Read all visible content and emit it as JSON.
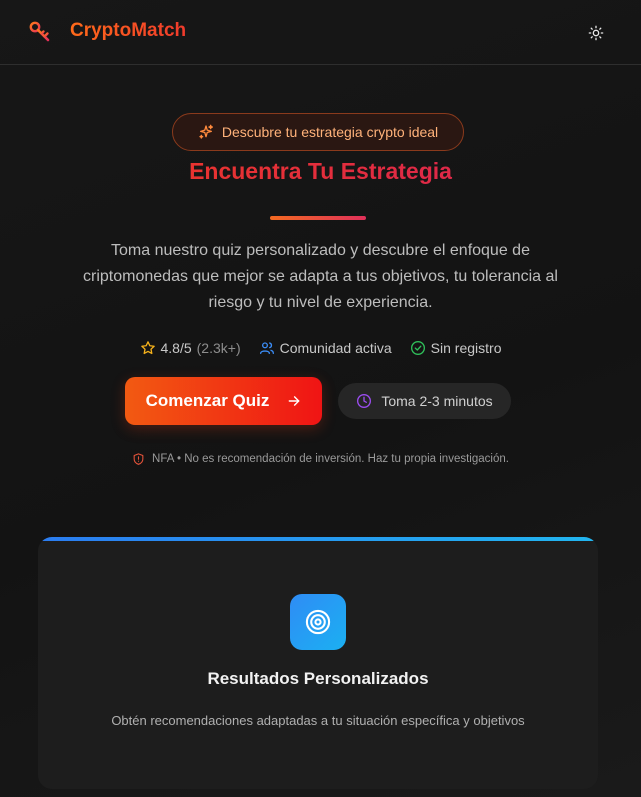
{
  "header": {
    "brand": "CryptoMatch",
    "logo_icon": "key-icon",
    "theme_icon": "sun-icon"
  },
  "hero": {
    "badge_icon": "sparkles-icon",
    "badge": "Descubre tu estrategia crypto ideal",
    "title": "Encuentra Tu Estrategia",
    "description": "Toma nuestro quiz personalizado y descubre el enfoque de criptomonedas que mejor se adapta a tus objetivos, tu tolerancia al riesgo y tu nivel de experiencia.",
    "rating": "4.8/5",
    "rating_count": "(2.3k+)",
    "community": "Comunidad activa",
    "no_signup": "Sin registro",
    "cta_label": "Comenzar Quiz",
    "time_label": "Toma 2-3 minutos",
    "disclaimer": "NFA • No es recomendación de inversión. Haz tu propia investigación."
  },
  "feature_card": {
    "icon": "target-icon",
    "title": "Resultados Personalizados",
    "description": "Obtén recomendaciones adaptadas a tu situación específica y objetivos"
  },
  "colors": {
    "background": "#141414",
    "brand_orange": "#f25a12",
    "brand_red": "#f01414",
    "card_accent": "#2b7cf0"
  }
}
